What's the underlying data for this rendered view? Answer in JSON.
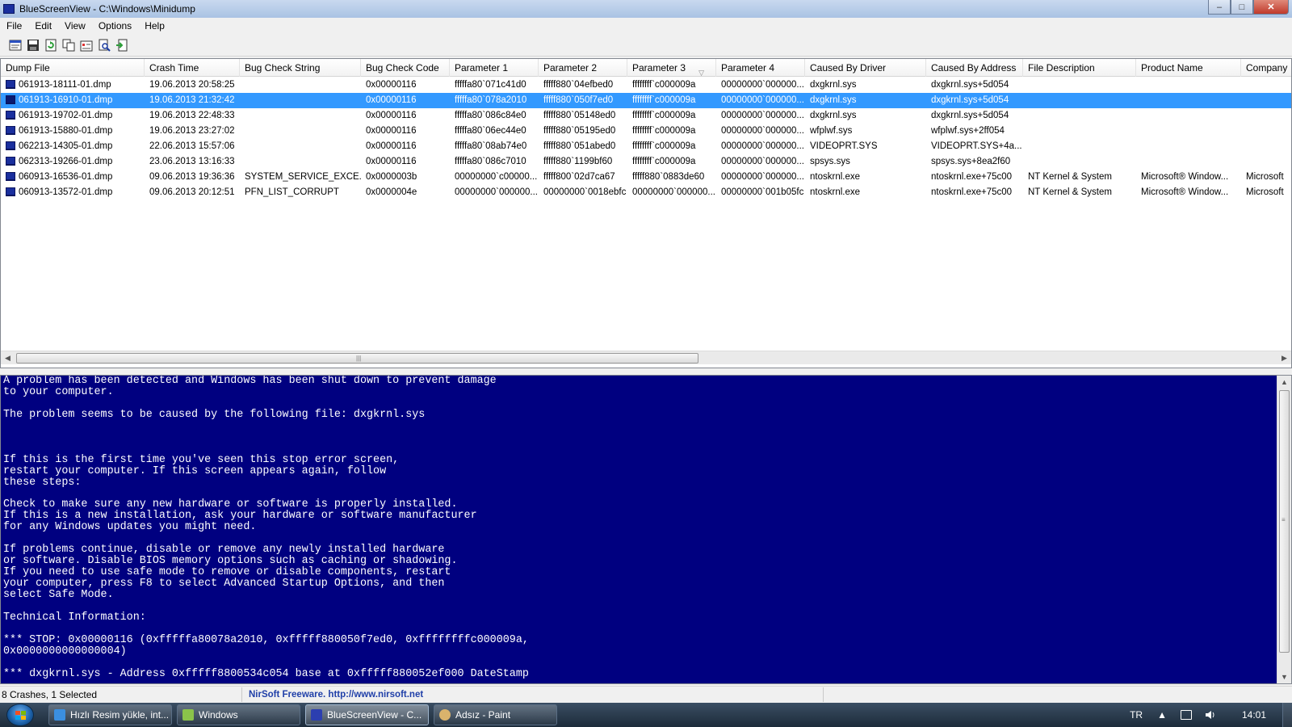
{
  "window": {
    "title": "BlueScreenView  -  C:\\Windows\\Minidump",
    "controls": {
      "minimize": "–",
      "maximize": "□",
      "close": "✕"
    }
  },
  "menu": [
    "File",
    "Edit",
    "View",
    "Options",
    "Help"
  ],
  "toolbar": {
    "buttons": [
      "html-report-icon",
      "save-icon",
      "refresh-icon",
      "copy-icon",
      "properties-icon",
      "find-icon",
      "exit-icon"
    ]
  },
  "list": {
    "columns": [
      "Dump File",
      "Crash Time",
      "Bug Check String",
      "Bug Check Code",
      "Parameter 1",
      "Parameter 2",
      "Parameter 3",
      "Parameter 4",
      "Caused By Driver",
      "Caused By Address",
      "File Description",
      "Product Name",
      "Company"
    ],
    "sort_indicator": "▽",
    "rows": [
      [
        "061913-18111-01.dmp",
        "19.06.2013 20:58:25",
        "",
        "0x00000116",
        "fffffa80`071c41d0",
        "fffff880`04efbed0",
        "ffffffff`c000009a",
        "00000000`000000...",
        "dxgkrnl.sys",
        "dxgkrnl.sys+5d054",
        "",
        "",
        ""
      ],
      [
        "061913-16910-01.dmp",
        "19.06.2013 21:32:42",
        "",
        "0x00000116",
        "fffffa80`078a2010",
        "fffff880`050f7ed0",
        "ffffffff`c000009a",
        "00000000`000000...",
        "dxgkrnl.sys",
        "dxgkrnl.sys+5d054",
        "",
        "",
        ""
      ],
      [
        "061913-19702-01.dmp",
        "19.06.2013 22:48:33",
        "",
        "0x00000116",
        "fffffa80`086c84e0",
        "fffff880`05148ed0",
        "ffffffff`c000009a",
        "00000000`000000...",
        "dxgkrnl.sys",
        "dxgkrnl.sys+5d054",
        "",
        "",
        ""
      ],
      [
        "061913-15880-01.dmp",
        "19.06.2013 23:27:02",
        "",
        "0x00000116",
        "fffffa80`06ec44e0",
        "fffff880`05195ed0",
        "ffffffff`c000009a",
        "00000000`000000...",
        "wfplwf.sys",
        "wfplwf.sys+2ff054",
        "",
        "",
        ""
      ],
      [
        "062213-14305-01.dmp",
        "22.06.2013 15:57:06",
        "",
        "0x00000116",
        "fffffa80`08ab74e0",
        "fffff880`051abed0",
        "ffffffff`c000009a",
        "00000000`000000...",
        "VIDEOPRT.SYS",
        "VIDEOPRT.SYS+4a...",
        "",
        "",
        ""
      ],
      [
        "062313-19266-01.dmp",
        "23.06.2013 13:16:33",
        "",
        "0x00000116",
        "fffffa80`086c7010",
        "fffff880`1199bf60",
        "ffffffff`c000009a",
        "00000000`000000...",
        "spsys.sys",
        "spsys.sys+8ea2f60",
        "",
        "",
        ""
      ],
      [
        "060913-16536-01.dmp",
        "09.06.2013 19:36:36",
        "SYSTEM_SERVICE_EXCE...",
        "0x0000003b",
        "00000000`c00000...",
        "fffff800`02d7ca67",
        "fffff880`0883de60",
        "00000000`000000...",
        "ntoskrnl.exe",
        "ntoskrnl.exe+75c00",
        "NT Kernel & System",
        "Microsoft® Window...",
        "Microsoft"
      ],
      [
        "060913-13572-01.dmp",
        "09.06.2013 20:12:51",
        "PFN_LIST_CORRUPT",
        "0x0000004e",
        "00000000`000000...",
        "00000000`0018ebfc",
        "00000000`000000...",
        "00000000`001b05fc",
        "ntoskrnl.exe",
        "ntoskrnl.exe+75c00",
        "NT Kernel & System",
        "Microsoft® Window...",
        "Microsoft"
      ]
    ],
    "selected_index": 1
  },
  "bsod": {
    "text": "A problem has been detected and Windows has been shut down to prevent damage\nto your computer.\n\nThe problem seems to be caused by the following file: dxgkrnl.sys\n\n\n\nIf this is the first time you've seen this stop error screen,\nrestart your computer. If this screen appears again, follow\nthese steps:\n\nCheck to make sure any new hardware or software is properly installed.\nIf this is a new installation, ask your hardware or software manufacturer\nfor any Windows updates you might need.\n\nIf problems continue, disable or remove any newly installed hardware\nor software. Disable BIOS memory options such as caching or shadowing.\nIf you need to use safe mode to remove or disable components, restart\nyour computer, press F8 to select Advanced Startup Options, and then\nselect Safe Mode.\n\nTechnical Information:\n\n*** STOP: 0x00000116 (0xfffffa80078a2010, 0xfffff880050f7ed0, 0xffffffffc000009a,\n0x0000000000000004)\n\n*** dxgkrnl.sys - Address 0xfffff8800534c054 base at 0xfffff880052ef000 DateStamp"
  },
  "status": {
    "summary": "8 Crashes, 1 Selected",
    "link": "NirSoft Freeware.  http://www.nirsoft.net"
  },
  "taskbar": {
    "buttons": [
      {
        "label": "Hızlı Resim yükle, int...",
        "icon": "ie-icon",
        "color": "#3b8fe0"
      },
      {
        "label": "Windows",
        "icon": "explorer-icon",
        "color": "#8bc34a"
      },
      {
        "label": "BlueScreenView - C...",
        "icon": "bluescreenview-icon",
        "color": "#2c3fb0"
      },
      {
        "label": "Adsız - Paint",
        "icon": "paint-icon",
        "color": "#d9b36c"
      }
    ],
    "language": "TR",
    "clock": "14:01"
  },
  "colors": {
    "selection": "#3399ff",
    "bsod_background": "#000080",
    "link": "#1f3fa8"
  }
}
